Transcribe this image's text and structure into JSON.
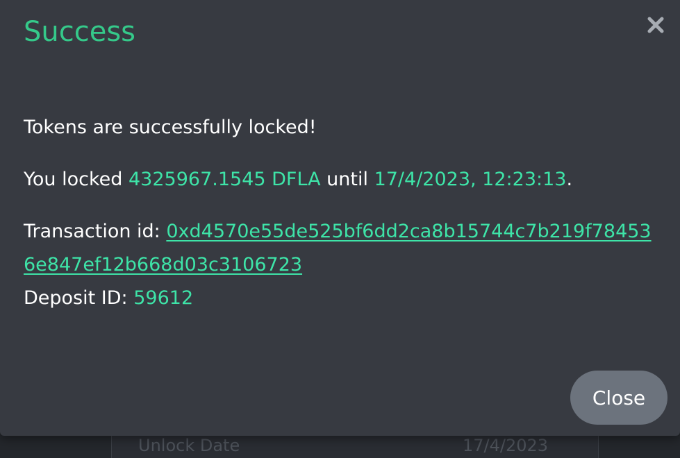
{
  "modal": {
    "title": "Success",
    "close_icon": "close-x-icon",
    "message": "Tokens are successfully locked!",
    "locked_prefix": "You locked ",
    "locked_amount": "4325967.1545 DFLA",
    "locked_until_text": " until ",
    "unlock_datetime": "17/4/2023, 12:23:13",
    "locked_suffix": ".",
    "transaction_label": "Transaction id: ",
    "transaction_id": "0xd4570e55de525bf6dd2ca8b15744c7b219f784536e847ef12b668d03c3106723",
    "deposit_label": "Deposit ID: ",
    "deposit_id": "59612",
    "close_button_label": "Close"
  },
  "background": {
    "row_label": "Unlock Date",
    "row_value": "17/4/2023"
  },
  "colors": {
    "accent": "#35c98a",
    "highlight": "#3ee4a8",
    "modal_bg": "#373a41",
    "button_bg": "#6c737d"
  }
}
